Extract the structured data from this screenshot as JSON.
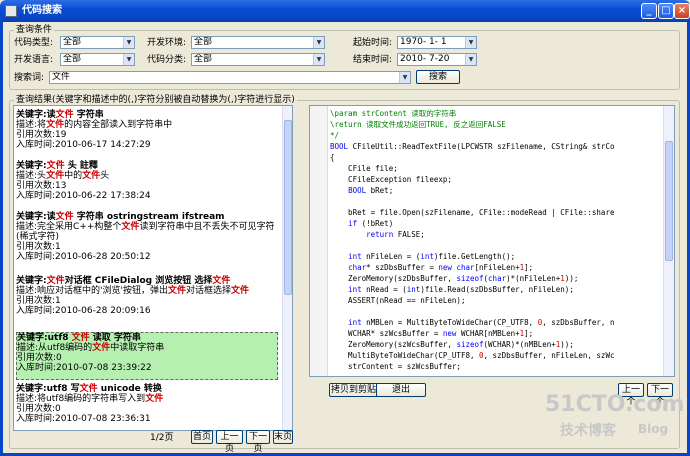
{
  "window": {
    "title": "代码搜索",
    "minimize": "_",
    "maximize": "□",
    "close": "×"
  },
  "query": {
    "group_title": "查询条件",
    "code_type_label": "代码类型:",
    "code_type_value": "全部",
    "dev_env_label": "开发环境:",
    "dev_env_value": "全部",
    "start_time_label": "起始时间:",
    "start_time_value": "1970- 1- 1",
    "dev_lang_label": "开发语言:",
    "dev_lang_value": "全部",
    "code_class_label": "代码分类:",
    "code_class_value": "全部",
    "end_time_label": "结束时间:",
    "end_time_value": "2010- 7-20",
    "keyword_label": "搜索词:",
    "keyword_value": "文件",
    "search_button": "搜索"
  },
  "results": {
    "title": "查询结果(关键字和描述中的(,)字符分别被自动替换为(,)字符进行显示)",
    "items": [
      {
        "kw_label": "关键字:",
        "kw": [
          [
            "读",
            0
          ],
          [
            "文件",
            1
          ],
          [
            " 字符串",
            0
          ]
        ],
        "desc_label": "描述:",
        "desc": [
          [
            "将",
            0
          ],
          [
            "文件",
            1
          ],
          [
            "的内容全部读入到字符串中",
            0
          ]
        ],
        "refs": "引用次数:19",
        "time": "入库时间:2010-06-17 14:27:29"
      },
      {
        "kw_label": "关键字:",
        "kw": [
          [
            "文件",
            1
          ],
          [
            " 头 註釋",
            0
          ]
        ],
        "desc_label": "描述:",
        "desc": [
          [
            "头",
            0
          ],
          [
            "文件",
            1
          ],
          [
            "中的",
            0
          ],
          [
            "文件",
            1
          ],
          [
            "头",
            0
          ]
        ],
        "refs": "引用次数:13",
        "time": "入库时间:2010-06-22 17:38:24"
      },
      {
        "kw_label": "关键字:",
        "kw": [
          [
            "读",
            0
          ],
          [
            "文件",
            1
          ],
          [
            " 字符串 ostringstream ifstream",
            0
          ]
        ],
        "desc_label": "描述:",
        "desc": [
          [
            "完全采用C++构整个",
            0
          ],
          [
            "文件",
            1
          ],
          [
            "读到字符串中且不丢失不可见字符(稀式字符)",
            0
          ]
        ],
        "refs": "引用次数:1",
        "time": "入库时间:2010-06-28 20:50:12"
      },
      {
        "kw_label": "关键字:",
        "kw": [
          [
            "文件",
            1
          ],
          [
            "对话框 CFileDialog 浏览按钮 选择",
            0
          ],
          [
            "文件",
            1
          ]
        ],
        "desc_label": "描述:",
        "desc": [
          [
            "响应对话框中的'浏览'按钮，弹出",
            0
          ],
          [
            "文件",
            1
          ],
          [
            "对话框选择",
            0
          ],
          [
            "文件",
            1
          ]
        ],
        "refs": "引用次数:1",
        "time": "入库时间:2010-06-28 20:09:16"
      },
      {
        "kw_label": "关键字:",
        "kw": [
          [
            "utf8 ",
            0
          ],
          [
            "文件",
            1
          ],
          [
            " 读取 字符串",
            0
          ]
        ],
        "desc_label": "描述:",
        "desc": [
          [
            "从utf8编码的",
            0
          ],
          [
            "文件",
            1
          ],
          [
            "中读取字符串",
            0
          ]
        ],
        "refs": "引用次数:0",
        "time": "入库时间:2010-07-08 23:39:22"
      },
      {
        "kw_label": "关键字:",
        "kw": [
          [
            "utf8 写",
            0
          ],
          [
            "文件",
            1
          ],
          [
            " unicode 转换",
            0
          ]
        ],
        "desc_label": "描述:",
        "desc": [
          [
            "将utf8编码的字符串写入到",
            0
          ],
          [
            "文件",
            1
          ]
        ],
        "refs": "引用次数:0",
        "time": "入库时间:2010-07-08 23:36:31"
      }
    ],
    "pager": {
      "page": "1/2页",
      "first": "首页",
      "prev": "上一页",
      "next": "下一页",
      "last": "末页"
    }
  },
  "code": {
    "lines": [
      [
        [
          "\\param strContent 读取的字符串",
          "cm"
        ]
      ],
      [
        [
          "\\return 读取文件成功返回TRUE, 反之返回FALSE",
          "cm"
        ]
      ],
      [
        [
          "*/",
          "cm"
        ]
      ],
      [
        [
          "BOOL",
          "kwc"
        ],
        [
          " CFileUtil::ReadTextFile(LPCWSTR szFilename, CString& strCo",
          ""
        ]
      ],
      [
        [
          "{",
          ""
        ]
      ],
      [
        [
          "    CFile file;",
          ""
        ]
      ],
      [
        [
          "    CFileException fileexp;",
          ""
        ]
      ],
      [
        [
          "    ",
          ""
        ],
        [
          "BOOL",
          "kwc"
        ],
        [
          " bRet;",
          ""
        ]
      ],
      [
        [
          "",
          ""
        ]
      ],
      [
        [
          "    bRet = file.Open(szFilename, CFile::modeRead | CFile::share",
          ""
        ]
      ],
      [
        [
          "    ",
          ""
        ],
        [
          "if",
          "kwc"
        ],
        [
          " (!bRet)",
          ""
        ]
      ],
      [
        [
          "        ",
          ""
        ],
        [
          "return",
          "kwc"
        ],
        [
          " FALSE;",
          ""
        ]
      ],
      [
        [
          "",
          ""
        ]
      ],
      [
        [
          "    ",
          ""
        ],
        [
          "int",
          "kwc"
        ],
        [
          " nFileLen = (",
          ""
        ],
        [
          "int",
          "kwc"
        ],
        [
          ")file.GetLength();",
          ""
        ]
      ],
      [
        [
          "    ",
          ""
        ],
        [
          "char",
          "kwc"
        ],
        [
          "* szDbsBuffer = ",
          ""
        ],
        [
          "new",
          "kwc"
        ],
        [
          " ",
          ""
        ],
        [
          "char",
          "kwc"
        ],
        [
          "[nFileLen+",
          ""
        ],
        [
          "1",
          "num"
        ],
        [
          "];",
          ""
        ]
      ],
      [
        [
          "    ZeroMemory(szDbsBuffer, ",
          ""
        ],
        [
          "sizeof",
          "kwc"
        ],
        [
          "(",
          ""
        ],
        [
          "char",
          "kwc"
        ],
        [
          ")*(nFileLen+",
          ""
        ],
        [
          "1",
          "num"
        ],
        [
          "));",
          ""
        ]
      ],
      [
        [
          "    ",
          ""
        ],
        [
          "int",
          "kwc"
        ],
        [
          " nRead = (",
          ""
        ],
        [
          "int",
          "kwc"
        ],
        [
          ")file.Read(szDbsBuffer, nFileLen);",
          ""
        ]
      ],
      [
        [
          "    ASSERT(nRead == nFileLen);",
          ""
        ]
      ],
      [
        [
          "",
          ""
        ]
      ],
      [
        [
          "    ",
          ""
        ],
        [
          "int",
          "kwc"
        ],
        [
          " nMBLen = MultiByteToWideChar(CP_UTF8, ",
          ""
        ],
        [
          "0",
          "num"
        ],
        [
          ", szDbsBuffer, n",
          ""
        ]
      ],
      [
        [
          "    WCHAR* szWcsBuffer = ",
          ""
        ],
        [
          "new",
          "kwc"
        ],
        [
          " WCHAR[nMBLen+",
          ""
        ],
        [
          "1",
          "num"
        ],
        [
          "];",
          ""
        ]
      ],
      [
        [
          "    ZeroMemory(szWcsBuffer, ",
          ""
        ],
        [
          "sizeof",
          "kwc"
        ],
        [
          "(WCHAR)*(nMBLen+",
          ""
        ],
        [
          "1",
          "num"
        ],
        [
          "));",
          ""
        ]
      ],
      [
        [
          "    MultiByteToWideChar(CP_UTF8, ",
          ""
        ],
        [
          "0",
          "num"
        ],
        [
          ", szDbsBuffer, nFileLen, szWc",
          ""
        ]
      ],
      [
        [
          "    strContent = szWcsBuffer;",
          ""
        ]
      ]
    ],
    "copy_button": "拷贝到剪贴板",
    "exit_button": "退出",
    "prev_button": "上一个",
    "next_button": "下一个"
  },
  "watermark": {
    "line1": "51CTO.com",
    "line2": "技术博客",
    "line3": "Blog"
  }
}
